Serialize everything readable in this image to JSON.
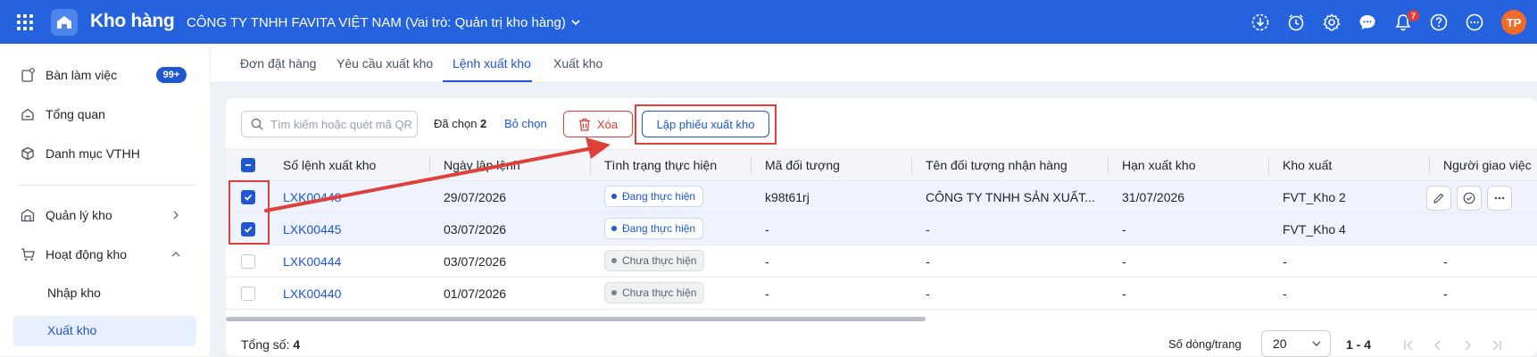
{
  "app": {
    "title": "Kho hàng",
    "company": "CÔNG TY TNHH FAVITA VIỆT NAM (Vai trò: Quản trị kho hàng)",
    "notification_count": "7",
    "user_initials": "TP"
  },
  "sidebar": {
    "items": [
      {
        "label": "Bàn làm việc",
        "badge": "99+"
      },
      {
        "label": "Tổng quan"
      },
      {
        "label": "Danh mục VTHH"
      },
      {
        "label": "Quản lý kho"
      },
      {
        "label": "Hoạt động kho"
      }
    ],
    "sub_items": [
      {
        "label": "Nhập kho"
      },
      {
        "label": "Xuất kho"
      }
    ]
  },
  "tabs": [
    {
      "label": "Đơn đặt hàng"
    },
    {
      "label": "Yêu cầu xuất kho"
    },
    {
      "label": "Lệnh xuất kho"
    },
    {
      "label": "Xuất kho"
    }
  ],
  "toolbar": {
    "search_placeholder": "Tìm kiếm hoặc quét mã QR",
    "selected_label": "Đã chọn",
    "selected_count": "2",
    "unselect_label": "Bỏ chọn",
    "delete_label": "Xóa",
    "create_label": "Lập phiếu xuất kho"
  },
  "table": {
    "columns": [
      "Số lệnh xuất kho",
      "Ngày lập lệnh",
      "Tình trạng thực hiện",
      "Mã đối tượng",
      "Tên đối tượng nhận hàng",
      "Hạn xuất kho",
      "Kho xuất",
      "Người giao việc"
    ],
    "rows": [
      {
        "code": "LXK00448",
        "date": "29/07/2026",
        "status": "Đang thực hiện",
        "object_code": "k98t61rj",
        "object_name": "CÔNG TY TNHH SẢN XUẤT...",
        "deadline": "31/07/2026",
        "warehouse": "FVT_Kho 2",
        "assigner": ""
      },
      {
        "code": "LXK00445",
        "date": "03/07/2026",
        "status": "Đang thực hiện",
        "object_code": "-",
        "object_name": "-",
        "deadline": "-",
        "warehouse": "FVT_Kho 4",
        "assigner": ""
      },
      {
        "code": "LXK00444",
        "date": "03/07/2026",
        "status": "Chưa thực hiện",
        "object_code": "-",
        "object_name": "-",
        "deadline": "-",
        "warehouse": "-",
        "assigner": "-"
      },
      {
        "code": "LXK00440",
        "date": "01/07/2026",
        "status": "Chưa thực hiện",
        "object_code": "-",
        "object_name": "-",
        "deadline": "-",
        "warehouse": "-",
        "assigner": "-"
      }
    ]
  },
  "footer": {
    "total_label": "Tổng số:",
    "total": "4",
    "rows_per_page_label": "Số dòng/trang",
    "rows_per_page": "20",
    "range": "1 - 4"
  },
  "colors": {
    "primary": "#2463dd",
    "accent": "#1f56d1",
    "danger": "#e53935",
    "annotation": "#e0403a"
  },
  "icons": [
    "apps-grid-icon",
    "warehouse-logo-icon",
    "download-icon",
    "clock-icon",
    "gear-icon",
    "chat-icon",
    "bell-icon",
    "help-icon",
    "more-icon"
  ]
}
